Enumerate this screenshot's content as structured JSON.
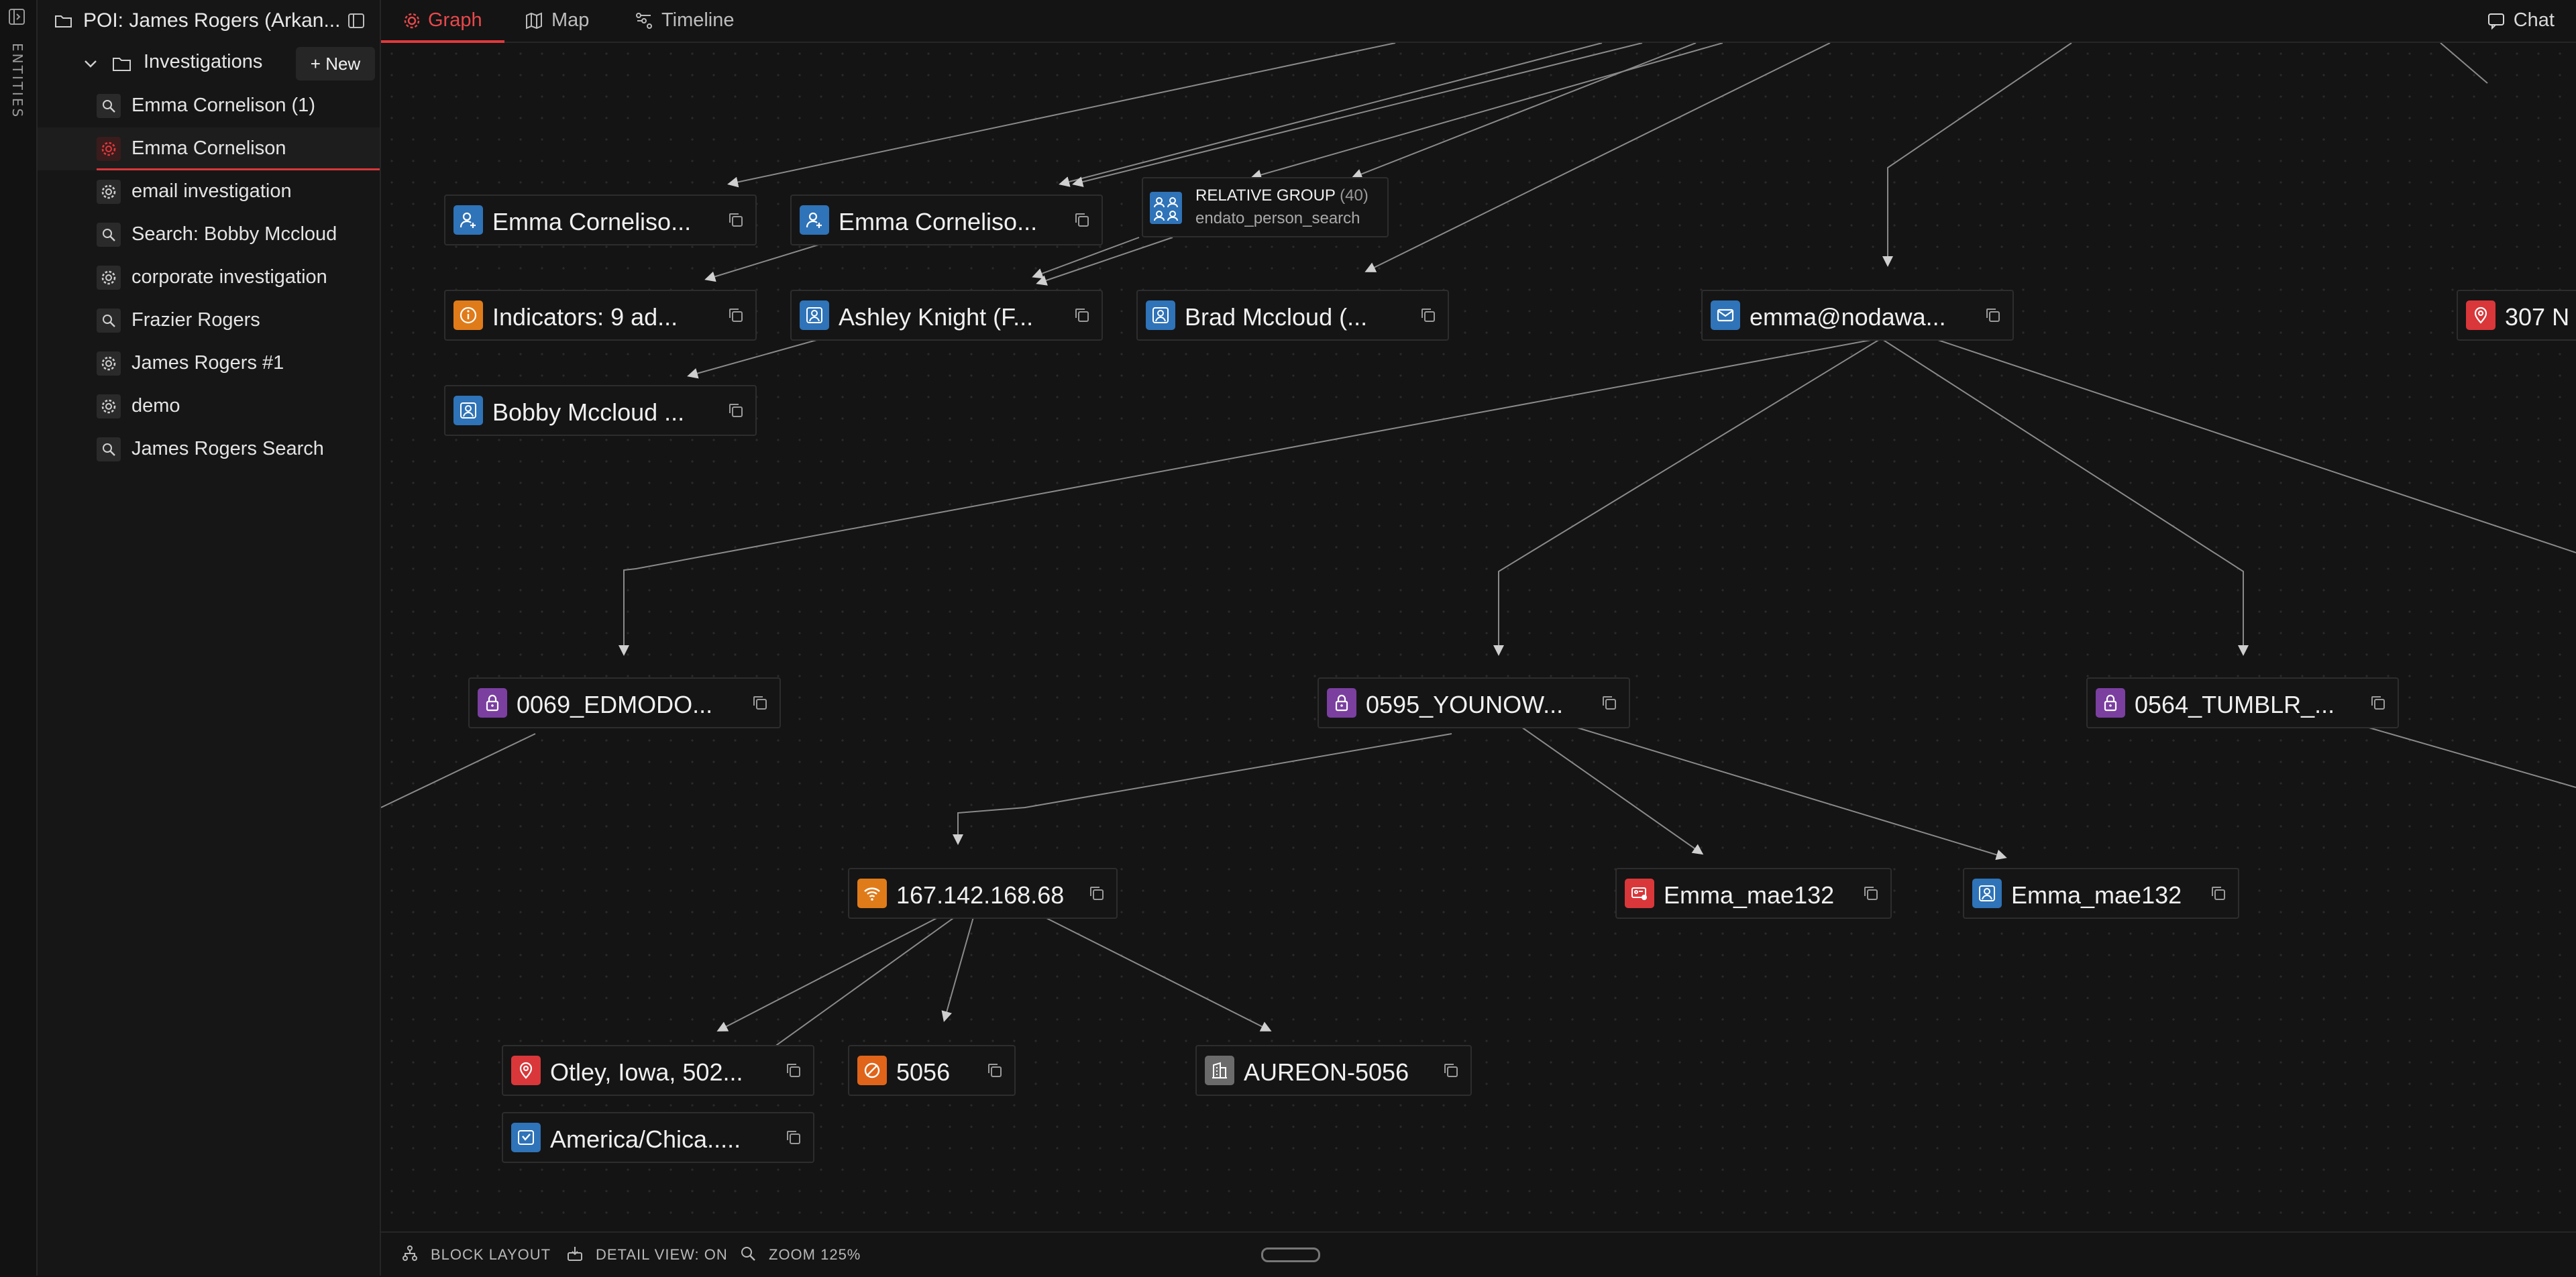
{
  "rail": {
    "label": "ENTITIES"
  },
  "sidebar": {
    "title": "POI: James Rogers (Arkan...",
    "section_label": "Investigations",
    "new_label": "+ New",
    "items": [
      {
        "label": "Emma Cornelison (1)",
        "icon": "search-icon"
      },
      {
        "label": "Emma Cornelison",
        "icon": "gear-icon",
        "active": true
      },
      {
        "label": "email investigation",
        "icon": "gear-icon"
      },
      {
        "label": "Search: Bobby Mccloud",
        "icon": "search-icon"
      },
      {
        "label": "corporate investigation",
        "icon": "gear-icon"
      },
      {
        "label": "Frazier Rogers",
        "icon": "search-icon"
      },
      {
        "label": "James Rogers #1",
        "icon": "gear-icon"
      },
      {
        "label": "demo",
        "icon": "gear-icon"
      },
      {
        "label": "James Rogers Search",
        "icon": "search-icon"
      }
    ]
  },
  "tabs": [
    {
      "label": "Graph",
      "icon": "gear-icon",
      "active": true
    },
    {
      "label": "Map",
      "icon": "map-icon"
    },
    {
      "label": "Timeline",
      "icon": "timeline-icon"
    }
  ],
  "chat_label": "Chat",
  "nodes": {
    "emma1": {
      "label": "Emma Corneliso...",
      "icon": "person-add-icon",
      "color": "#2f73b8"
    },
    "emma2": {
      "label": "Emma Corneliso...",
      "icon": "person-add-icon",
      "color": "#2f73b8"
    },
    "indicators": {
      "label": "Indicators: 9 ad...",
      "icon": "info-icon",
      "color": "#e07b1a"
    },
    "ashley": {
      "label": "Ashley Knight (F...",
      "icon": "person-icon",
      "color": "#2f73b8"
    },
    "brad": {
      "label": "Brad Mccloud (...",
      "icon": "person-icon",
      "color": "#2f73b8"
    },
    "email": {
      "label": "emma@nodawa...",
      "icon": "mail-icon",
      "color": "#2f73b8"
    },
    "addr307": {
      "label": "307 N",
      "icon": "location-pin-icon",
      "color": "#d9373a"
    },
    "bobby": {
      "label": "Bobby Mccloud ...",
      "icon": "person-icon",
      "color": "#2f73b8"
    },
    "edmodo": {
      "label": "0069_EDMODO...",
      "icon": "lock-icon",
      "color": "#7b3fa0"
    },
    "younow": {
      "label": "0595_YOUNOW...",
      "icon": "lock-icon",
      "color": "#7b3fa0"
    },
    "tumblr": {
      "label": "0564_TUMBLR_...",
      "icon": "lock-icon",
      "color": "#7b3fa0"
    },
    "ip": {
      "label": "167.142.168.68",
      "icon": "wifi-icon",
      "color": "#e07b1a"
    },
    "mae1": {
      "label": "Emma_mae132",
      "icon": "username-icon",
      "color": "#d9373a"
    },
    "mae2": {
      "label": "Emma_mae132",
      "icon": "person-icon",
      "color": "#2f73b8"
    },
    "otley": {
      "label": "Otley, Iowa, 502...",
      "icon": "location-pin-icon",
      "color": "#d9373a"
    },
    "n5056": {
      "label": "5056",
      "icon": "no-symbol-icon",
      "color": "#e0641a"
    },
    "aureon": {
      "label": "AUREON-5056",
      "icon": "building-icon",
      "color": "#6b6b6b"
    },
    "tz": {
      "label": "America/Chica.....",
      "icon": "timezone-icon",
      "color": "#2f73b8"
    }
  },
  "group": {
    "title": "RELATIVE GROUP",
    "count": "(40)",
    "subtitle": "endato_person_search"
  },
  "bottom": {
    "layout": "BLOCK LAYOUT",
    "detail": "DETAIL VIEW: ON",
    "zoom": "ZOOM 125%"
  }
}
